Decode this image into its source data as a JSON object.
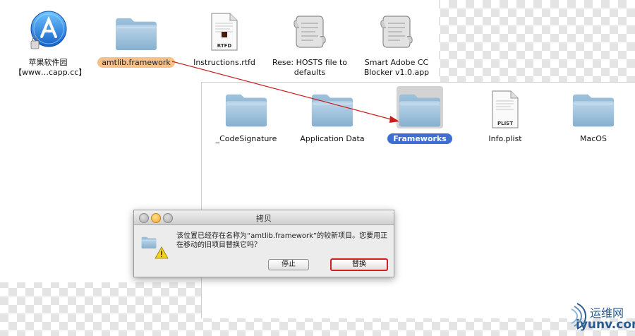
{
  "desktop_items": [
    {
      "label_line1": "苹果软件园",
      "label_line2": "【www…capp.cc】",
      "icon": "app-store-icon"
    },
    {
      "label": "amtlib.framework",
      "icon": "folder-icon",
      "state": "dragged"
    },
    {
      "label": "Instructions.rtfd",
      "icon": "rtfd-document-icon",
      "badge": "RTFD"
    },
    {
      "label_line1": "Rese: HOSTS file to",
      "label_line2": "defaults",
      "icon": "script-icon"
    },
    {
      "label_line1": "Smart Adobe CC",
      "label_line2": "Blocker v1.0.app",
      "icon": "script-icon"
    }
  ],
  "window_items": [
    {
      "label": "_CodeSignature",
      "icon": "folder-icon"
    },
    {
      "label": "Application Data",
      "icon": "folder-icon"
    },
    {
      "label": "Frameworks",
      "icon": "folder-icon",
      "state": "selected"
    },
    {
      "label": "Info.plist",
      "icon": "plist-document-icon",
      "badge": "PLIST"
    },
    {
      "label": "MacOS",
      "icon": "folder-icon"
    }
  ],
  "dialog": {
    "title": "拷贝",
    "message": "该位置已经存在名称为“amtlib.framework”的较新项目。您要用正在移动的旧项目替换它吗？",
    "stop_label": "停止",
    "replace_label": "替换",
    "icon": "folder-warning-icon"
  },
  "watermark": {
    "cn": "运维网",
    "en": "iyunv.com"
  },
  "colors": {
    "folder": "#8fb7d6",
    "selection_blue": "#3d6fd2",
    "drag_label_orange": "#f7c086",
    "arrow_red": "#c81e1e",
    "replace_outline": "#d21f1f"
  }
}
